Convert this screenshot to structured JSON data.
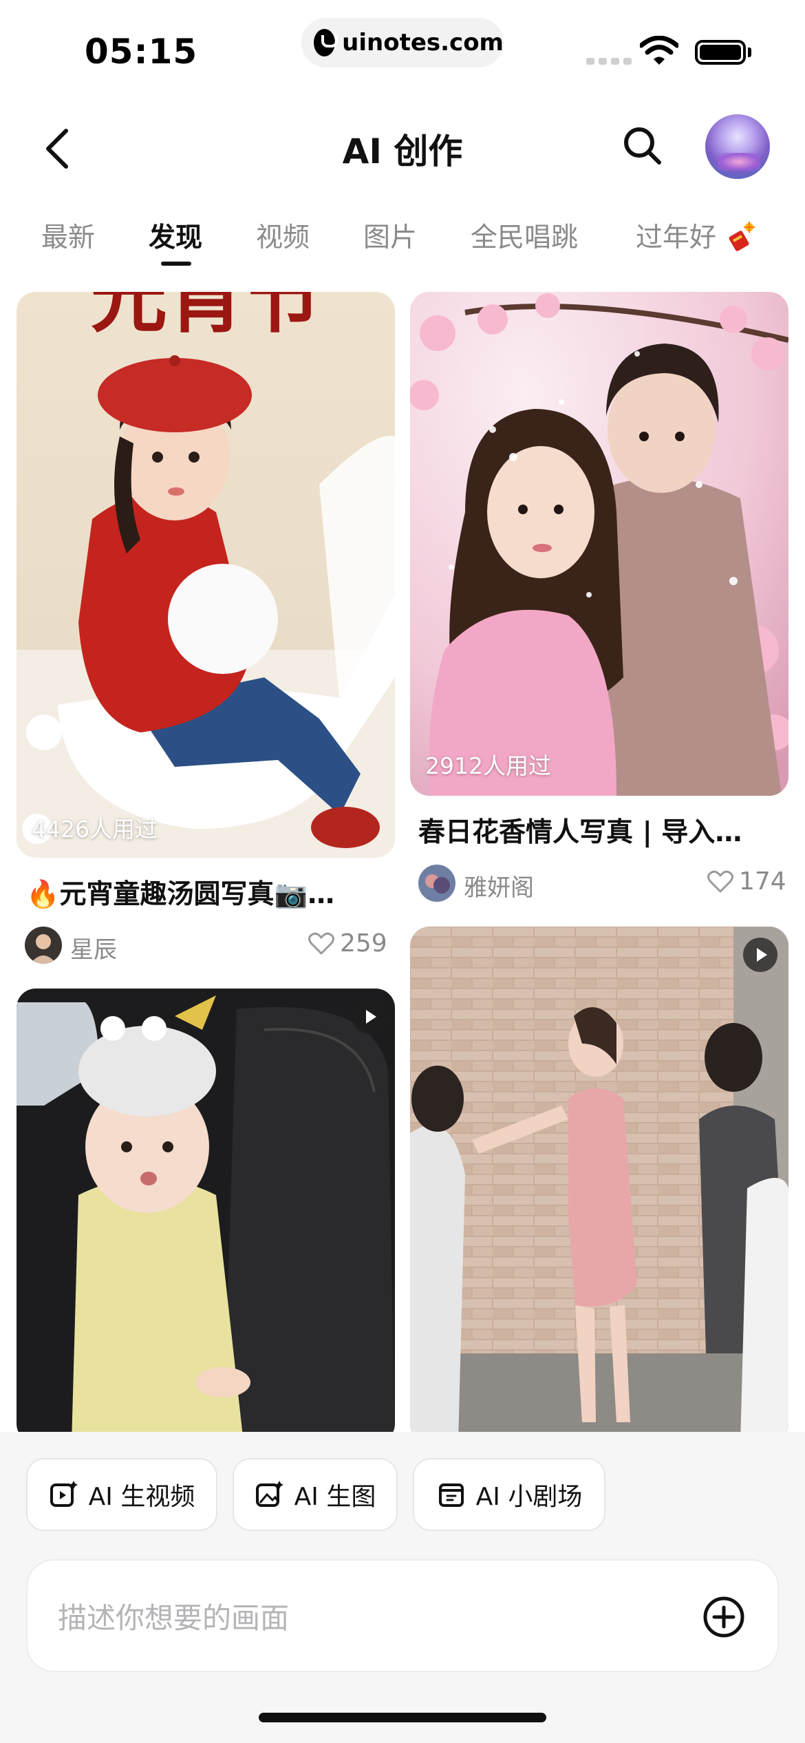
{
  "status_bar": {
    "time": "05:15",
    "url": "uinotes.com"
  },
  "header": {
    "title": "AI 创作"
  },
  "tabs": [
    {
      "label": "最新",
      "active": false
    },
    {
      "label": "发现",
      "active": true
    },
    {
      "label": "视频",
      "active": false
    },
    {
      "label": "图片",
      "active": false
    },
    {
      "label": "全民唱跳",
      "active": false
    },
    {
      "label": "过年好",
      "active": false,
      "emoji": "firecracker-icon"
    }
  ],
  "feed": [
    {
      "overlay_text": "元宵节",
      "usage": "4426人用过",
      "title": "🔥元宵童趣汤圆写真📷…",
      "author": "星辰",
      "likes": "259",
      "type": "image"
    },
    {
      "usage": "2912人用过",
      "title": "春日花香情人写真 | 导入…",
      "author": "雅妍阁",
      "likes": "174",
      "type": "image"
    },
    {
      "type": "video"
    },
    {
      "type": "video"
    }
  ],
  "actions": [
    {
      "label": "AI 生视频",
      "icon": "video-sparkle-icon"
    },
    {
      "label": "AI 生图",
      "icon": "image-sparkle-icon"
    },
    {
      "label": "AI 小剧场",
      "icon": "theater-icon"
    }
  ],
  "prompt": {
    "placeholder": "描述你想要的画面"
  },
  "colors": {
    "accent": "#111111",
    "muted_text": "#8a8a8a",
    "panel_bg": "#f6f6f7"
  }
}
